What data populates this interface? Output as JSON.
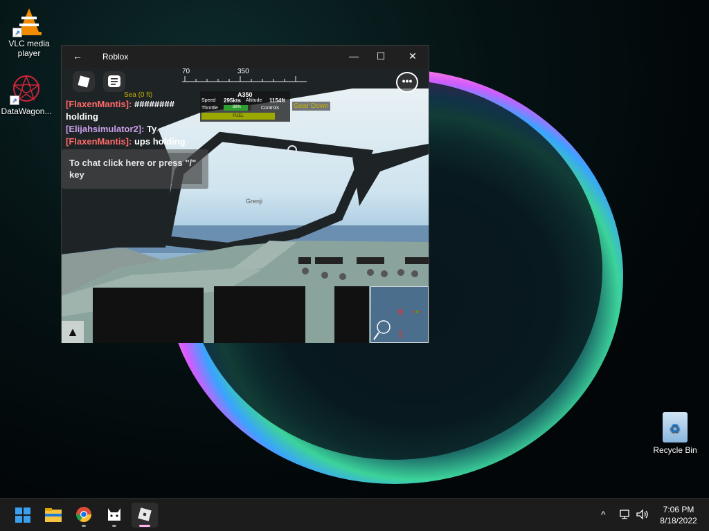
{
  "desktop": {
    "icons": [
      {
        "label": "VLC media player"
      },
      {
        "label": "DataWagon..."
      }
    ],
    "recycle_bin": {
      "label": "Recycle Bin"
    }
  },
  "window": {
    "title": "Roblox",
    "back_glyph": "←",
    "minimize_glyph": "—",
    "maximize_glyph": "☐",
    "close_glyph": "✕"
  },
  "game": {
    "compass": {
      "left_label": "70",
      "center_label": "350"
    },
    "sea_info": "Sea (0 ft)",
    "hud": {
      "model": "A350",
      "speed_label": "Speed",
      "speed_value": "295kts",
      "altitude_label": "Altitude",
      "altitude_value": "1154ft",
      "throttle_label": "Throttle",
      "throttle_value": "88%",
      "throttle_fraction": 0.88,
      "controls_label": "Controls",
      "fuel_label": "FUEL"
    },
    "gear_status": "Gear Down",
    "player_tag": "Grenji",
    "more_glyph": "•••",
    "jump_glyph": "▲",
    "chat": {
      "lines": [
        {
          "name": "[FlaxenMantis]:",
          "name_color": "#ff6b6b",
          "text": "########"
        },
        {
          "name": "",
          "name_color": "#ff6b6b",
          "text": "holding"
        },
        {
          "name": "[Elijahsimulator2]:",
          "name_color": "#c9a0e8",
          "text": "Ty"
        },
        {
          "name": "[FlaxenMantis]:",
          "name_color": "#ff6b6b",
          "text": "ups holding"
        }
      ],
      "input_placeholder": "To chat click here or press \"/\" key"
    }
  },
  "taskbar": {
    "apps": [
      {
        "name": "start",
        "active": false
      },
      {
        "name": "file-explorer",
        "active": false
      },
      {
        "name": "chrome",
        "active": false
      },
      {
        "name": "cat-app",
        "active": false
      },
      {
        "name": "roblox",
        "active": true
      }
    ],
    "clock": {
      "time": "7:06 PM",
      "date": "8/18/2022"
    },
    "tray_chevron": "^"
  }
}
